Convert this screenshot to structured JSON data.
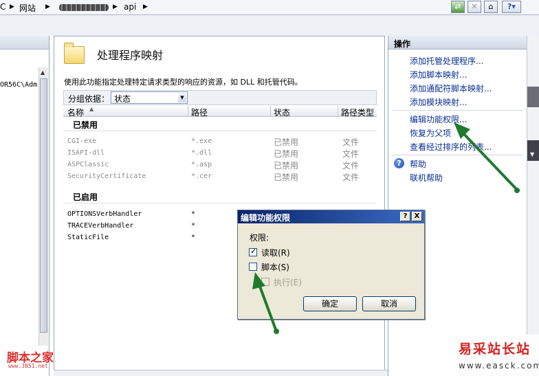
{
  "address_bar": {
    "crumbs": [
      "C",
      "网站",
      "api"
    ],
    "icon_names": [
      "refresh-icon",
      "stop-icon",
      "home-icon",
      "help-icon"
    ]
  },
  "connections": {
    "tree_text": "OR56C\\Adm"
  },
  "feature": {
    "title": "处理程序映射",
    "description": "使用此功能指定处理特定请求类型的响应的资源，如 DLL 和托管代码。",
    "group_label": "分组依据：",
    "group_value": "状态",
    "columns": [
      "名称",
      "路径",
      "状态",
      "路径类型"
    ],
    "groups": [
      {
        "name": "已禁用",
        "rows": [
          {
            "name": "CGI-exe",
            "path": "*.exe",
            "state": "已禁用",
            "type": "文件"
          },
          {
            "name": "ISAPI-dll",
            "path": "*.dll",
            "state": "已禁用",
            "type": "文件"
          },
          {
            "name": "ASPClassic",
            "path": "*.asp",
            "state": "已禁用",
            "type": "文件"
          },
          {
            "name": "SecurityCertificate",
            "path": "*.cer",
            "state": "已禁用",
            "type": "文件"
          }
        ]
      },
      {
        "name": "已启用",
        "rows": [
          {
            "name": "OPTIONSVerbHandler",
            "path": "*",
            "state": "",
            "type": ""
          },
          {
            "name": "TRACEVerbHandler",
            "path": "*",
            "state": "",
            "type": ""
          },
          {
            "name": "StaticFile",
            "path": "*",
            "state": "",
            "type": ""
          }
        ]
      }
    ]
  },
  "actions": {
    "header": "操作",
    "items": [
      "添加托管处理程序...",
      "添加脚本映射...",
      "添加通配符脚本映射...",
      "添加模块映射..."
    ],
    "items2": [
      "编辑功能权限...",
      "恢复为父项",
      "查看经过排序的列表..."
    ],
    "help": [
      "帮助",
      "联机帮助"
    ]
  },
  "dialog": {
    "title": "编辑功能权限",
    "help_btn": "?",
    "close_btn": "X",
    "group_label": "权限:",
    "read": {
      "label": "读取(R)",
      "checked": true
    },
    "script": {
      "label": "脚本(S)",
      "checked": false
    },
    "execute": {
      "label": "执行(E)",
      "checked": false,
      "disabled": true
    },
    "ok": "确定",
    "cancel": "取消"
  },
  "annotation_color": "#1f7a2e",
  "watermarks": {
    "left_title": "脚本之家",
    "left_sub": "www.JB51.net",
    "right_title": "易采站长站",
    "right_sub": "www.easck.com"
  }
}
